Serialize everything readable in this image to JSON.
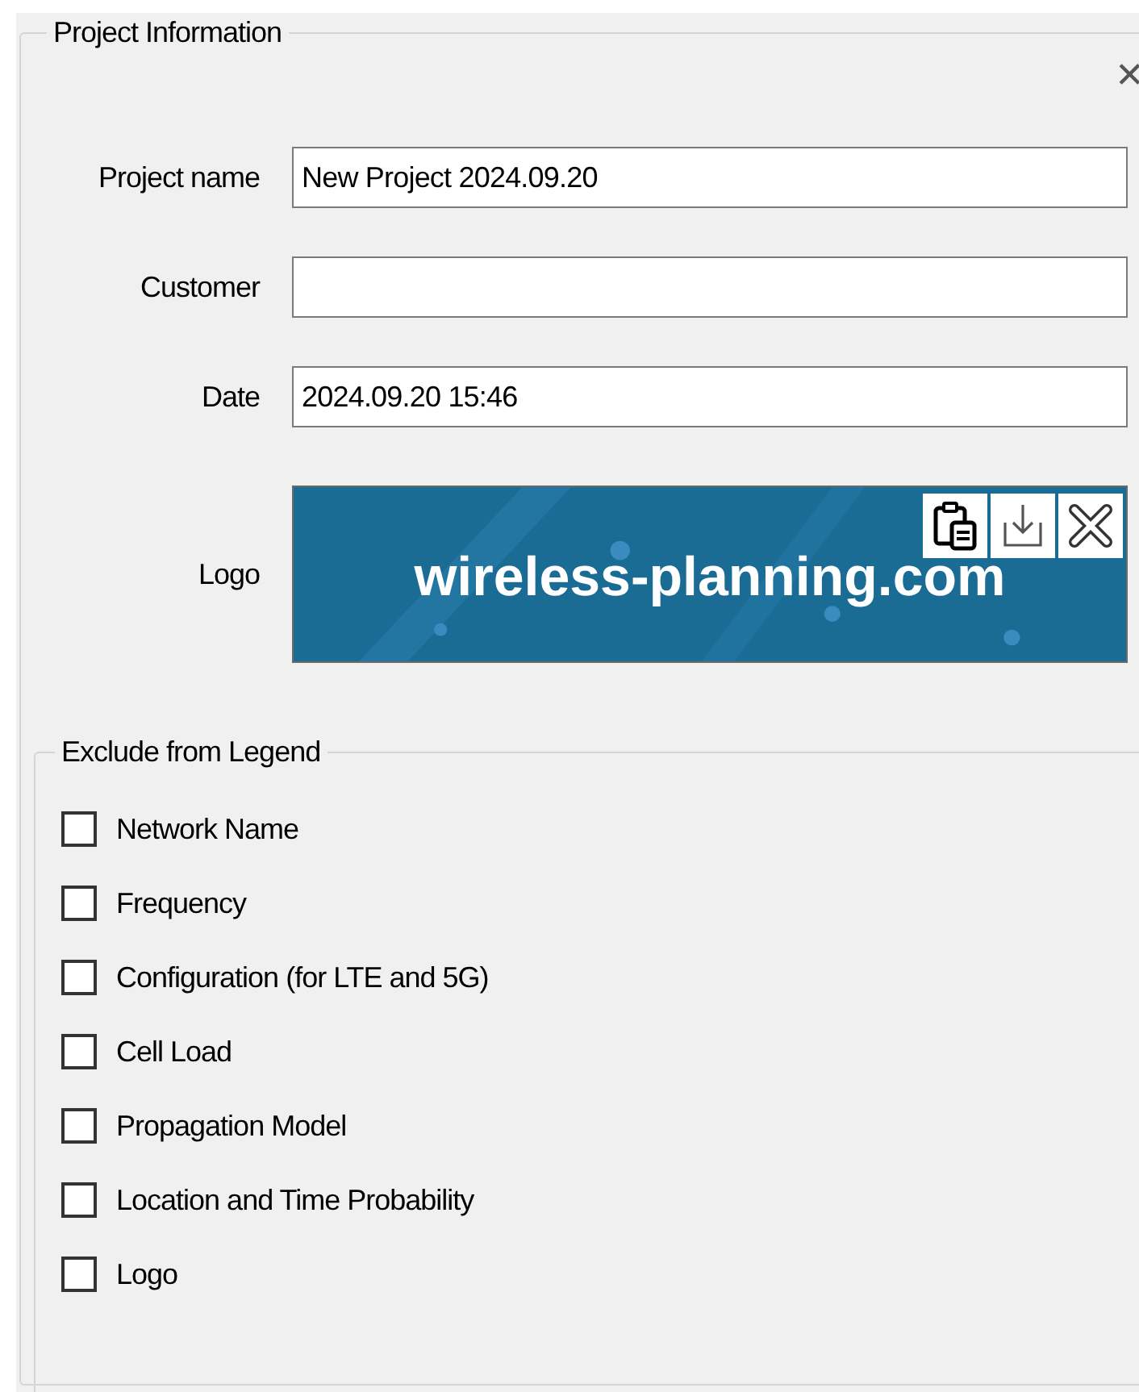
{
  "group": {
    "title": "Project Information",
    "close": "✕"
  },
  "fields": [
    {
      "label": "Project name",
      "value": "New Project 2024.09.20"
    },
    {
      "label": "Customer"
    },
    {
      "label": "Date",
      "value": "2024.09.20 15:46"
    }
  ],
  "logo": {
    "label": "Logo",
    "text": "wireless-planning.com"
  },
  "legend": {
    "title": "Exclude from Legend",
    "options": [
      {
        "label": "Network Name",
        "checked": false
      },
      {
        "label": "Frequency",
        "checked": false
      },
      {
        "label": "Configuration (for LTE and 5G)",
        "checked": false
      },
      {
        "label": "Cell Load",
        "checked": false
      },
      {
        "label": "Propagation Model",
        "checked": false
      },
      {
        "label": "Location and Time Probability",
        "checked": false
      },
      {
        "label": "Logo",
        "checked": false
      }
    ]
  }
}
